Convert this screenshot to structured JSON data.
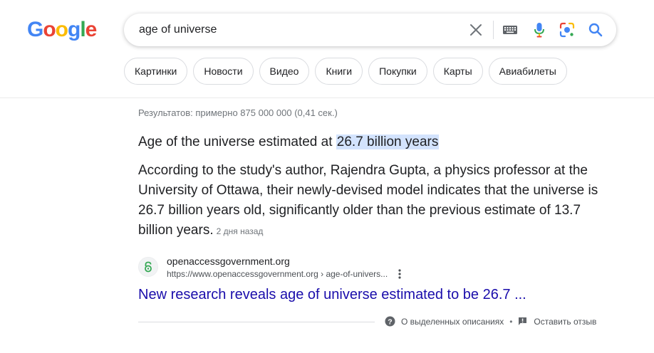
{
  "header": {
    "logo_letters": [
      {
        "char": "G",
        "color": "#4285F4"
      },
      {
        "char": "o",
        "color": "#EA4335"
      },
      {
        "char": "o",
        "color": "#FBBC05"
      },
      {
        "char": "g",
        "color": "#4285F4"
      },
      {
        "char": "l",
        "color": "#34A853"
      },
      {
        "char": "e",
        "color": "#EA4335"
      }
    ],
    "search": {
      "query": "age of universe",
      "icons": [
        "close-icon",
        "keyboard-icon",
        "microphone-icon",
        "lens-icon",
        "search-icon"
      ]
    }
  },
  "chips": [
    {
      "label": "Картинки"
    },
    {
      "label": "Новости"
    },
    {
      "label": "Видео"
    },
    {
      "label": "Книги"
    },
    {
      "label": "Покупки"
    },
    {
      "label": "Карты"
    },
    {
      "label": "Авиабилеты"
    }
  ],
  "results": {
    "stats": "Результатов: примерно 875 000 000 (0,41 сек.)",
    "featured": {
      "title_prefix": "Age of the universe estimated at ",
      "title_highlight": "26.7 billion years",
      "snippet": "According to the study's author, Rajendra Gupta, a physics professor at the University of Ottawa, their newly-devised model indicates that the universe is 26.7 billion years old, significantly older than the previous estimate of 13.7 billion years.",
      "date": "2 дня назад"
    },
    "source": {
      "site_name": "openaccessgovernment.org",
      "url": "https://www.openaccessgovernment.org › age-of-univers...",
      "link_title": "New research reveals age of universe estimated to be 26.7 ..."
    },
    "footer": {
      "about_label": "О выделенных описаниях",
      "separator": "•",
      "feedback_label": "Оставить отзыв"
    }
  },
  "colors": {
    "link": "#1a0dab",
    "highlight": "#d3e3fd",
    "muted": "#70757a"
  }
}
